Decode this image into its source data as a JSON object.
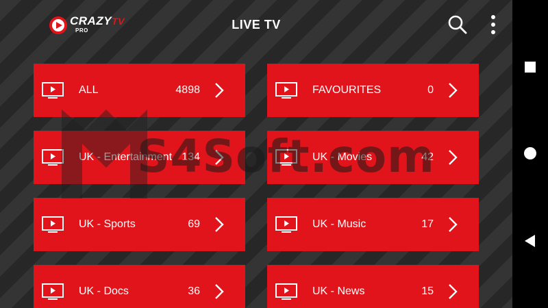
{
  "header": {
    "logo_text": "CRAZY",
    "logo_tv": "TV",
    "logo_pro": "PRO",
    "title": "LIVE TV",
    "search_icon": "search-icon",
    "menu_icon": "more-vert-icon"
  },
  "categories": [
    {
      "label": "ALL",
      "count": "4898"
    },
    {
      "label": "FAVOURITES",
      "count": "0"
    },
    {
      "label": "UK - Entertainment",
      "count": "134"
    },
    {
      "label": "UK - Movies",
      "count": "42"
    },
    {
      "label": "UK - Sports",
      "count": "69"
    },
    {
      "label": "UK - Music",
      "count": "17"
    },
    {
      "label": "UK - Docs",
      "count": "36"
    },
    {
      "label": "UK - News",
      "count": "15"
    }
  ],
  "watermark": {
    "text": "S4Soft.com"
  },
  "colors": {
    "accent": "#e0141a",
    "background": "#2b2b2b",
    "navbar": "#000000"
  },
  "navigation": {
    "icons": [
      "square-icon",
      "circle-icon",
      "triangle-back-icon"
    ]
  }
}
